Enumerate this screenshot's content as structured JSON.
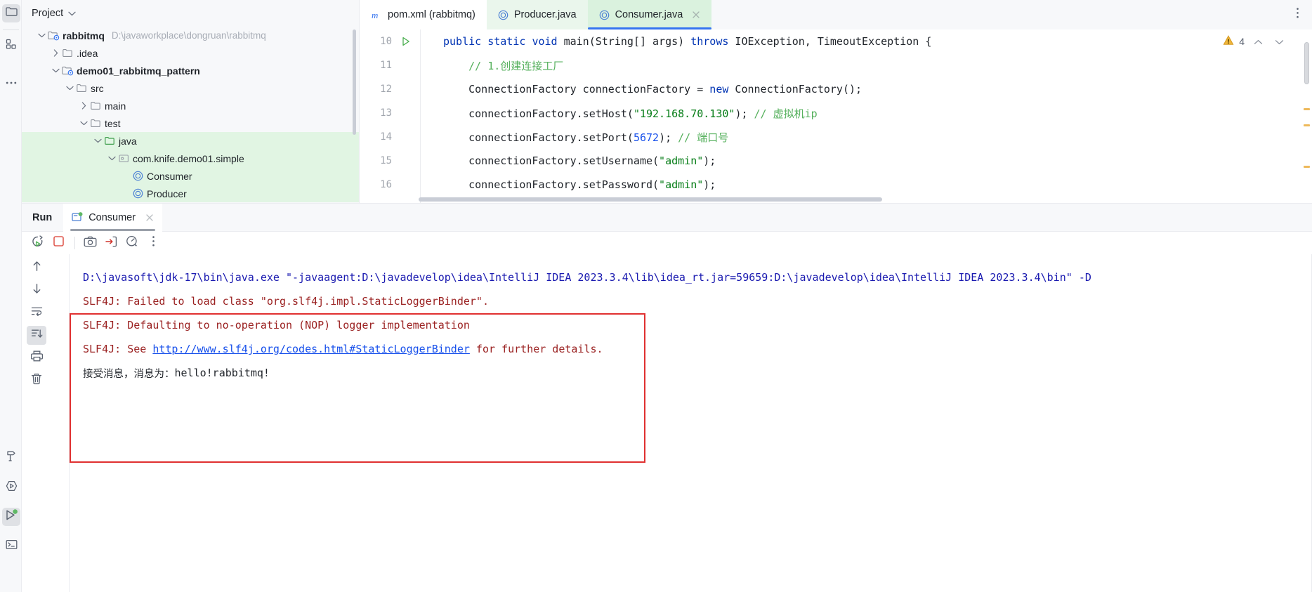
{
  "activity_bar": {
    "items": [
      {
        "name": "project-tool-window",
        "icon": "folder-icon",
        "selected": true
      },
      {
        "name": "structure-tool-window",
        "icon": "structure-icon",
        "selected": false
      },
      {
        "name": "more-tool-windows",
        "icon": "ellipsis-icon",
        "selected": false
      },
      {
        "name": "build-tool-window",
        "icon": "hammer-icon",
        "selected": false
      },
      {
        "name": "run-anything",
        "icon": "run-hexagon-icon",
        "selected": false
      },
      {
        "name": "run-tool-window",
        "icon": "run-play-green-icon",
        "selected": true
      },
      {
        "name": "terminal-tool-window",
        "icon": "terminal-icon",
        "selected": false
      }
    ]
  },
  "project_panel": {
    "title": "Project",
    "dropdown_icon": "chevron-down-icon",
    "tree": [
      {
        "label": "rabbitmq",
        "path": "D:\\javaworkplace\\dongruan\\rabbitmq",
        "indent": 0,
        "twisty": "expanded",
        "icon": "module-folder-icon",
        "bold": true,
        "highlight": false
      },
      {
        "label": ".idea",
        "path": "",
        "indent": 1,
        "twisty": "collapsed",
        "icon": "folder-icon",
        "bold": false,
        "highlight": false
      },
      {
        "label": "demo01_rabbitmq_pattern",
        "path": "",
        "indent": 1,
        "twisty": "expanded",
        "icon": "module-folder-icon",
        "bold": true,
        "highlight": false
      },
      {
        "label": "src",
        "path": "",
        "indent": 2,
        "twisty": "expanded",
        "icon": "folder-icon",
        "bold": false,
        "highlight": false
      },
      {
        "label": "main",
        "path": "",
        "indent": 3,
        "twisty": "collapsed",
        "icon": "folder-icon",
        "bold": false,
        "highlight": false
      },
      {
        "label": "test",
        "path": "",
        "indent": 3,
        "twisty": "expanded",
        "icon": "folder-icon",
        "bold": false,
        "highlight": false
      },
      {
        "label": "java",
        "path": "",
        "indent": 4,
        "twisty": "expanded",
        "icon": "source-test-folder-icon",
        "bold": false,
        "highlight": true
      },
      {
        "label": "com.knife.demo01.simple",
        "path": "",
        "indent": 5,
        "twisty": "expanded",
        "icon": "package-icon",
        "bold": false,
        "highlight": true
      },
      {
        "label": "Consumer",
        "path": "",
        "indent": 6,
        "twisty": "none",
        "icon": "java-class-icon",
        "bold": false,
        "highlight": true
      },
      {
        "label": "Producer",
        "path": "",
        "indent": 6,
        "twisty": "none",
        "icon": "java-class-icon",
        "bold": false,
        "highlight": true
      }
    ]
  },
  "editor": {
    "tabs": [
      {
        "label": "pom.xml (rabbitmq)",
        "icon": "maven-m-icon",
        "state": "pom",
        "closable": false
      },
      {
        "label": "Producer.java",
        "icon": "java-class-icon",
        "state": "green",
        "closable": false
      },
      {
        "label": "Consumer.java",
        "icon": "java-class-icon",
        "state": "active",
        "closable": true
      }
    ],
    "more_icon": "vertical-ellipsis-icon",
    "inspection": {
      "warning_icon": "warning-triangle-icon",
      "warning_count": "4",
      "prev_icon": "chevron-up-icon",
      "next_icon": "chevron-down-icon"
    },
    "lines": [
      {
        "number": "10",
        "gutter_icon": "run-gutter-play-icon",
        "tokens": [
          {
            "t": "public",
            "c": "kw"
          },
          {
            "t": " ",
            "c": "id"
          },
          {
            "t": "static",
            "c": "kw"
          },
          {
            "t": " ",
            "c": "id"
          },
          {
            "t": "void",
            "c": "kw"
          },
          {
            "t": " ",
            "c": "id"
          },
          {
            "t": "main",
            "c": "fn"
          },
          {
            "t": "(",
            "c": "id"
          },
          {
            "t": "String",
            "c": "id"
          },
          {
            "t": "[] args) ",
            "c": "id"
          },
          {
            "t": "throws",
            "c": "kw"
          },
          {
            "t": " IOException, TimeoutException {",
            "c": "id"
          }
        ]
      },
      {
        "number": "11",
        "gutter_icon": "",
        "tokens": [
          {
            "t": "    ",
            "c": "id"
          },
          {
            "t": "// ",
            "c": "cmt-green"
          },
          {
            "t": "1.创建连接工厂",
            "c": "cmt-green"
          }
        ]
      },
      {
        "number": "12",
        "gutter_icon": "",
        "tokens": [
          {
            "t": "    ConnectionFactory connectionFactory = ",
            "c": "id"
          },
          {
            "t": "new",
            "c": "kw"
          },
          {
            "t": " ConnectionFactory();",
            "c": "id"
          }
        ]
      },
      {
        "number": "13",
        "gutter_icon": "",
        "tokens": [
          {
            "t": "    connectionFactory.setHost(",
            "c": "id"
          },
          {
            "t": "\"192.168.70.130\"",
            "c": "str"
          },
          {
            "t": "); ",
            "c": "id"
          },
          {
            "t": "// ",
            "c": "cmt-green"
          },
          {
            "t": "虚拟机ip",
            "c": "cmt-green"
          }
        ]
      },
      {
        "number": "14",
        "gutter_icon": "",
        "tokens": [
          {
            "t": "    connectionFactory.setPort(",
            "c": "id"
          },
          {
            "t": "5672",
            "c": "num"
          },
          {
            "t": "); ",
            "c": "id"
          },
          {
            "t": "// ",
            "c": "cmt-green"
          },
          {
            "t": "端口号",
            "c": "cmt-green"
          }
        ]
      },
      {
        "number": "15",
        "gutter_icon": "",
        "tokens": [
          {
            "t": "    connectionFactory.setUsername(",
            "c": "id"
          },
          {
            "t": "\"admin\"",
            "c": "str"
          },
          {
            "t": ");",
            "c": "id"
          }
        ]
      },
      {
        "number": "16",
        "gutter_icon": "",
        "tokens": [
          {
            "t": "    connectionFactory.setPassword(",
            "c": "id"
          },
          {
            "t": "\"admin\"",
            "c": "str"
          },
          {
            "t": ");",
            "c": "id"
          }
        ]
      }
    ]
  },
  "run_panel": {
    "title": "Run",
    "tab": {
      "label": "Consumer",
      "icon": "run-config-icon",
      "close_icon": "close-icon"
    },
    "toolbar": [
      {
        "name": "rerun-button",
        "icon": "rerun-icon"
      },
      {
        "name": "stop-button",
        "icon": "stop-square-icon"
      },
      {
        "name": "separator",
        "icon": "separator"
      },
      {
        "name": "screenshot-button",
        "icon": "camera-icon"
      },
      {
        "name": "import-button",
        "icon": "import-arrow-icon"
      },
      {
        "name": "profiler-button",
        "icon": "gauge-icon"
      },
      {
        "name": "more-options-button",
        "icon": "vertical-ellipsis-icon"
      }
    ],
    "side_toolbar": [
      {
        "name": "previous-occurrence-button",
        "icon": "arrow-up-icon",
        "selected": false
      },
      {
        "name": "next-occurrence-button",
        "icon": "arrow-down-icon",
        "selected": false
      },
      {
        "name": "soft-wrap-button",
        "icon": "soft-wrap-icon",
        "selected": false
      },
      {
        "name": "scroll-to-end-button",
        "icon": "scroll-to-end-icon",
        "selected": true
      },
      {
        "name": "print-button",
        "icon": "printer-icon",
        "selected": false
      },
      {
        "name": "clear-all-button",
        "icon": "trash-icon",
        "selected": false
      }
    ],
    "console_lines": [
      {
        "segments": [
          {
            "t": "D:\\javasoft\\jdk-17\\bin\\java.exe \"-javaagent:D:\\javadevelop\\idea\\IntelliJ IDEA 2023.3.4\\lib\\idea_rt.jar=59659:D:\\javadevelop\\idea\\IntelliJ IDEA 2023.3.4\\bin\" -D",
            "c": "c-cmd"
          }
        ]
      },
      {
        "segments": [
          {
            "t": "SLF4J: Failed to load class \"org.slf4j.impl.StaticLoggerBinder\".",
            "c": "c-err"
          }
        ]
      },
      {
        "segments": [
          {
            "t": "SLF4J: Defaulting to no-operation (NOP) logger implementation",
            "c": "c-err"
          }
        ]
      },
      {
        "segments": [
          {
            "t": "SLF4J: See ",
            "c": "c-err"
          },
          {
            "t": "http://www.slf4j.org/codes.html#StaticLoggerBinder",
            "c": "c-link"
          },
          {
            "t": " for further details.",
            "c": "c-err"
          }
        ]
      },
      {
        "segments": [
          {
            "t": "接受消息，消息为：",
            "c": "c-out c-out-cjk"
          },
          {
            "t": "hello!rabbitmq!",
            "c": "c-out"
          }
        ]
      }
    ],
    "annotation": {
      "name": "red-highlight-box",
      "color": "#e03030"
    }
  },
  "colors": {
    "accent_blue": "#3574f0",
    "tab_active_green": "#daf2de",
    "tree_highlight_green": "#e1f5e3",
    "warning_amber": "#eeb95b",
    "annotation_red": "#e03030",
    "console_command_blue": "#1a1ab0",
    "console_error_red": "#9b2222"
  }
}
